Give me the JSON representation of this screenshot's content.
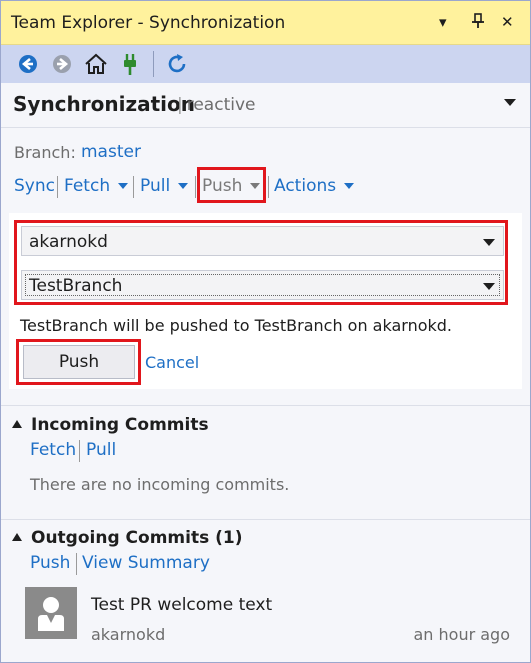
{
  "window": {
    "title": "Team Explorer - Synchronization",
    "pin_glyph": "⊥",
    "close_glyph": "✕",
    "menu_glyph": "▾"
  },
  "toolbar": {
    "icons": [
      "back-icon",
      "forward-icon",
      "home-icon",
      "connect-plug-icon",
      "refresh-icon"
    ]
  },
  "header": {
    "title": "Synchronization",
    "separator": "|",
    "repo": "reactive"
  },
  "branch": {
    "label": "Branch:",
    "name": "master"
  },
  "actions": {
    "sync": "Sync",
    "fetch": "Fetch",
    "pull": "Pull",
    "push": "Push",
    "actions": "Actions"
  },
  "push_panel": {
    "remote": "akarnokd",
    "branch": "TestBranch",
    "message": "TestBranch will be pushed to TestBranch on akarnokd.",
    "push_button": "Push",
    "cancel": "Cancel"
  },
  "incoming": {
    "title": "Incoming Commits",
    "fetch": "Fetch",
    "pull": "Pull",
    "empty_text": "There are no incoming commits."
  },
  "outgoing": {
    "title": "Outgoing Commits (1)",
    "push": "Push",
    "view_summary": "View Summary",
    "commits": [
      {
        "message": "Test PR welcome text",
        "author": "akarnokd",
        "time": "an hour ago"
      }
    ]
  },
  "colors": {
    "title_bar": "#fff29d",
    "toolbar": "#ccd5f0",
    "link": "#1e6fc5",
    "highlight": "#e1161c"
  }
}
